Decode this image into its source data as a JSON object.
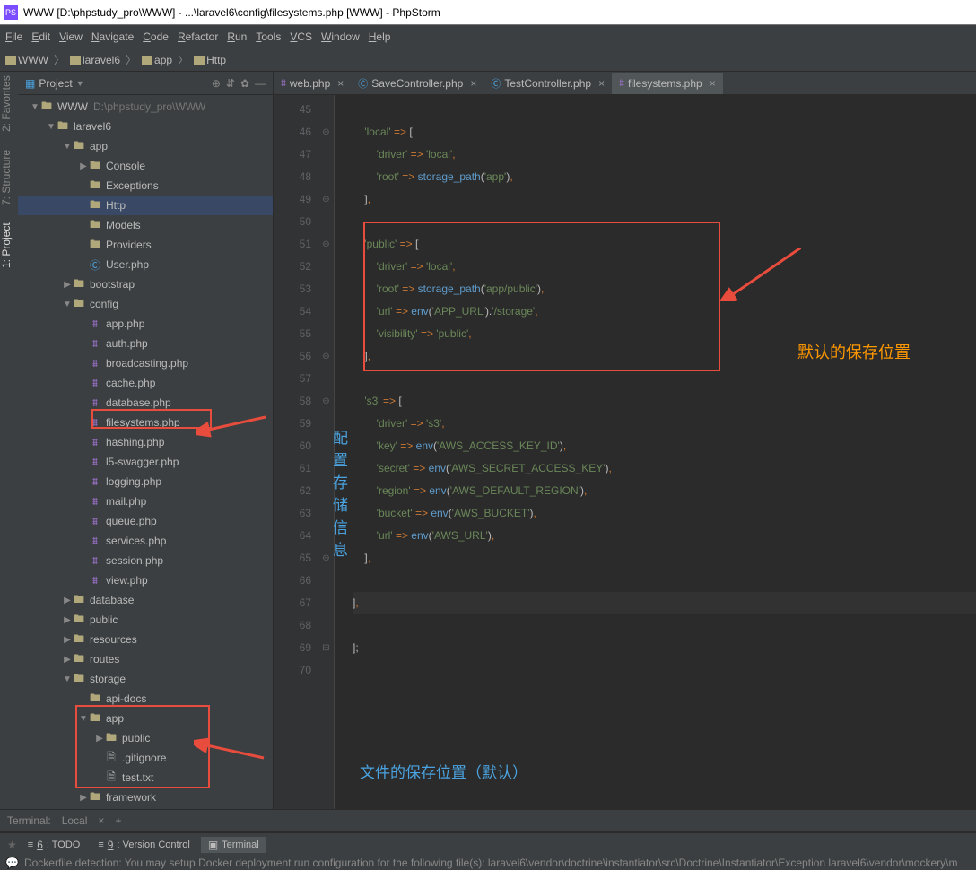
{
  "title": "WWW [D:\\phpstudy_pro\\WWW] - ...\\laravel6\\config\\filesystems.php [WWW] - PhpStorm",
  "menubar": [
    "File",
    "Edit",
    "View",
    "Navigate",
    "Code",
    "Refactor",
    "Run",
    "Tools",
    "VCS",
    "Window",
    "Help"
  ],
  "breadcrumbs": [
    "WWW",
    "laravel6",
    "app",
    "Http"
  ],
  "project_label": "Project",
  "tree": [
    {
      "d": 0,
      "arrow": "open",
      "icon": "folder",
      "name": "WWW",
      "path": "D:\\phpstudy_pro\\WWW"
    },
    {
      "d": 1,
      "arrow": "open",
      "icon": "folder",
      "name": "laravel6"
    },
    {
      "d": 2,
      "arrow": "open",
      "icon": "folder",
      "name": "app"
    },
    {
      "d": 3,
      "arrow": "closed",
      "icon": "folder",
      "name": "Console"
    },
    {
      "d": 3,
      "arrow": "",
      "icon": "folder",
      "name": "Exceptions"
    },
    {
      "d": 3,
      "arrow": "",
      "icon": "folder",
      "name": "Http",
      "sel": true
    },
    {
      "d": 3,
      "arrow": "",
      "icon": "folder",
      "name": "Models"
    },
    {
      "d": 3,
      "arrow": "",
      "icon": "folder",
      "name": "Providers"
    },
    {
      "d": 3,
      "arrow": "none",
      "icon": "class",
      "name": "User.php"
    },
    {
      "d": 2,
      "arrow": "closed",
      "icon": "folder",
      "name": "bootstrap"
    },
    {
      "d": 2,
      "arrow": "open",
      "icon": "folder",
      "name": "config"
    },
    {
      "d": 3,
      "arrow": "none",
      "icon": "php",
      "name": "app.php"
    },
    {
      "d": 3,
      "arrow": "none",
      "icon": "php",
      "name": "auth.php"
    },
    {
      "d": 3,
      "arrow": "none",
      "icon": "php",
      "name": "broadcasting.php"
    },
    {
      "d": 3,
      "arrow": "none",
      "icon": "php",
      "name": "cache.php"
    },
    {
      "d": 3,
      "arrow": "none",
      "icon": "php",
      "name": "database.php"
    },
    {
      "d": 3,
      "arrow": "none",
      "icon": "php",
      "name": "filesystems.php"
    },
    {
      "d": 3,
      "arrow": "none",
      "icon": "php",
      "name": "hashing.php"
    },
    {
      "d": 3,
      "arrow": "none",
      "icon": "php",
      "name": "l5-swagger.php"
    },
    {
      "d": 3,
      "arrow": "none",
      "icon": "php",
      "name": "logging.php"
    },
    {
      "d": 3,
      "arrow": "none",
      "icon": "php",
      "name": "mail.php"
    },
    {
      "d": 3,
      "arrow": "none",
      "icon": "php",
      "name": "queue.php"
    },
    {
      "d": 3,
      "arrow": "none",
      "icon": "php",
      "name": "services.php"
    },
    {
      "d": 3,
      "arrow": "none",
      "icon": "php",
      "name": "session.php"
    },
    {
      "d": 3,
      "arrow": "none",
      "icon": "php",
      "name": "view.php"
    },
    {
      "d": 2,
      "arrow": "closed",
      "icon": "folder",
      "name": "database"
    },
    {
      "d": 2,
      "arrow": "closed",
      "icon": "folder",
      "name": "public"
    },
    {
      "d": 2,
      "arrow": "closed",
      "icon": "folder",
      "name": "resources"
    },
    {
      "d": 2,
      "arrow": "closed",
      "icon": "folder",
      "name": "routes"
    },
    {
      "d": 2,
      "arrow": "open",
      "icon": "folder",
      "name": "storage"
    },
    {
      "d": 3,
      "arrow": "",
      "icon": "folder",
      "name": "api-docs"
    },
    {
      "d": 3,
      "arrow": "open",
      "icon": "folder",
      "name": "app"
    },
    {
      "d": 4,
      "arrow": "closed",
      "icon": "folder",
      "name": "public"
    },
    {
      "d": 4,
      "arrow": "none",
      "icon": "file",
      "name": ".gitignore"
    },
    {
      "d": 4,
      "arrow": "none",
      "icon": "file",
      "name": "test.txt"
    },
    {
      "d": 3,
      "arrow": "closed",
      "icon": "folder",
      "name": "framework"
    }
  ],
  "tabs": [
    {
      "name": "web.php",
      "icon": "php"
    },
    {
      "name": "SaveController.php",
      "icon": "class"
    },
    {
      "name": "TestController.php",
      "icon": "class"
    },
    {
      "name": "filesystems.php",
      "icon": "php",
      "active": true
    }
  ],
  "code_start": 45,
  "code": [
    "",
    "    <span class='s-str'>'local'</span> <span class='s-op'>=&gt;</span> <span class='s-br'>[</span>",
    "        <span class='s-str'>'driver'</span> <span class='s-op'>=&gt;</span> <span class='s-str'>'local'</span><span class='s-comma'>,</span>",
    "        <span class='s-str'>'root'</span> <span class='s-op'>=&gt;</span> <span class='s-fn'>storage_path</span>(<span class='s-str'>'app'</span>)<span class='s-comma'>,</span>",
    "    <span class='s-br'>]</span><span class='s-comma'>,</span>",
    "",
    "    <span class='s-str'>'public'</span> <span class='s-op'>=&gt;</span> <span class='s-br'>[</span>",
    "        <span class='s-str'>'driver'</span> <span class='s-op'>=&gt;</span> <span class='s-str'>'local'</span><span class='s-comma'>,</span>",
    "        <span class='s-str'>'root'</span> <span class='s-op'>=&gt;</span> <span class='s-fn'>storage_path</span>(<span class='s-str'>'app/public'</span>)<span class='s-comma'>,</span>",
    "        <span class='s-str'>'url'</span> <span class='s-op'>=&gt;</span> <span class='s-fn'>env</span>(<span class='s-str'>'APP_URL'</span>).<span class='s-str'>'/storage'</span><span class='s-comma'>,</span>",
    "        <span class='s-str'>'visibility'</span> <span class='s-op'>=&gt;</span> <span class='s-str'>'public'</span><span class='s-comma'>,</span>",
    "    <span class='s-br'>]</span><span class='s-comma'>,</span>",
    "",
    "    <span class='s-str'>'s3'</span> <span class='s-op'>=&gt;</span> <span class='s-br'>[</span>",
    "        <span class='s-str'>'driver'</span> <span class='s-op'>=&gt;</span> <span class='s-str'>'s3'</span><span class='s-comma'>,</span>",
    "        <span class='s-str'>'key'</span> <span class='s-op'>=&gt;</span> <span class='s-fn'>env</span>(<span class='s-str'>'AWS_ACCESS_KEY_ID'</span>)<span class='s-comma'>,</span>",
    "        <span class='s-str'>'secret'</span> <span class='s-op'>=&gt;</span> <span class='s-fn'>env</span>(<span class='s-str'>'AWS_SECRET_ACCESS_KEY'</span>)<span class='s-comma'>,</span>",
    "        <span class='s-str'>'region'</span> <span class='s-op'>=&gt;</span> <span class='s-fn'>env</span>(<span class='s-str'>'AWS_DEFAULT_REGION'</span>)<span class='s-comma'>,</span>",
    "        <span class='s-str'>'bucket'</span> <span class='s-op'>=&gt;</span> <span class='s-fn'>env</span>(<span class='s-str'>'AWS_BUCKET'</span>)<span class='s-comma'>,</span>",
    "        <span class='s-str'>'url'</span> <span class='s-op'>=&gt;</span> <span class='s-fn'>env</span>(<span class='s-str'>'AWS_URL'</span>)<span class='s-comma'>,</span>",
    "    <span class='s-br'>]</span><span class='s-comma'>,</span>",
    "",
    "<span class='s-br'>]</span><span class='s-comma'>,</span>",
    "",
    "<span class='s-br'>];</span>",
    ""
  ],
  "annotations": {
    "a1": "默认的保存位置",
    "a2": "配置存储信息",
    "a3": "文件的保存位置（默认）"
  },
  "terminal": {
    "label": "Terminal:",
    "tab": "Local"
  },
  "bottom_tabs": [
    {
      "label": "6: TODO",
      "u": "6"
    },
    {
      "label": "9: Version Control",
      "u": "9"
    },
    {
      "label": "Terminal",
      "active": true
    }
  ],
  "sidebar_vertical": [
    "1: Project",
    "7: Structure",
    "2: Favorites"
  ],
  "status": "Dockerfile detection: You may setup Docker deployment run configuration for the following file(s): laravel6\\vendor\\doctrine\\instantiator\\src\\Doctrine\\Instantiator\\Exception laravel6\\vendor\\mockery\\m"
}
